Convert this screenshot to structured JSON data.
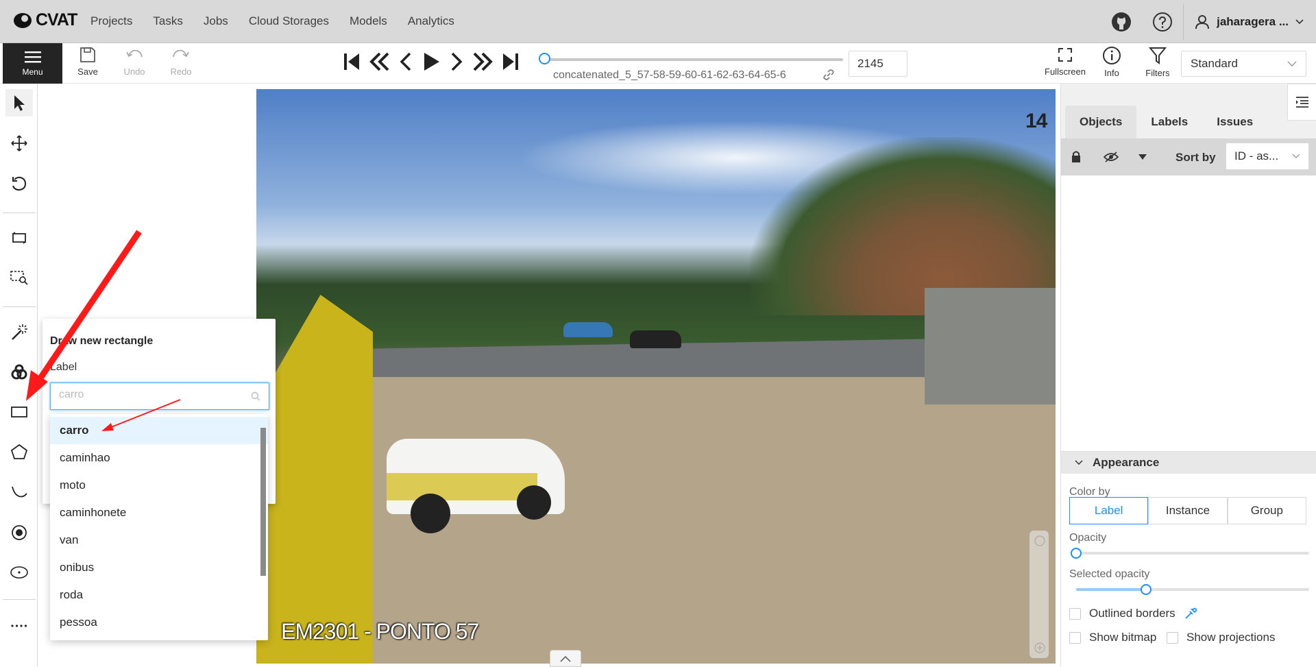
{
  "app": {
    "logo_text": "CVAT"
  },
  "nav": {
    "items": [
      "Projects",
      "Tasks",
      "Jobs",
      "Cloud Storages",
      "Models",
      "Analytics"
    ]
  },
  "user": {
    "name": "jaharagera ..."
  },
  "toolbar": {
    "menu_label": "Menu",
    "save_label": "Save",
    "undo_label": "Undo",
    "redo_label": "Redo",
    "filename": "concatenated_5_57-58-59-60-61-62-63-64-65-6",
    "frame_number": "2145",
    "fullscreen_label": "Fullscreen",
    "info_label": "Info",
    "filters_label": "Filters",
    "workspace": "Standard",
    "frame_progress": 0
  },
  "canvas": {
    "frame_overlay_number": "14",
    "watermark": "EM2301 - PONTO 57"
  },
  "draw_popover": {
    "title": "Draw new rectangle",
    "label_caption": "Label",
    "search_placeholder": "carro"
  },
  "label_dropdown": {
    "options": [
      "carro",
      "caminhao",
      "moto",
      "caminhonete",
      "van",
      "onibus",
      "roda",
      "pessoa"
    ],
    "selected": "carro"
  },
  "right_panel": {
    "tabs": [
      "Objects",
      "Labels",
      "Issues"
    ],
    "active_tab": "Objects",
    "sort_label": "Sort by",
    "sort_value": "ID - as...",
    "appearance": {
      "title": "Appearance",
      "color_by_label": "Color by",
      "color_by_options": [
        "Label",
        "Instance",
        "Group"
      ],
      "color_by_selected": "Label",
      "opacity_label": "Opacity",
      "opacity_value": 0,
      "selected_opacity_label": "Selected opacity",
      "selected_opacity_value": 0.3,
      "outlined_borders_label": "Outlined borders",
      "show_bitmap_label": "Show bitmap",
      "show_projections_label": "Show projections"
    }
  },
  "colors": {
    "accent": "#1890ff",
    "annotation_arrow": "#ff1a1a",
    "menu_bg": "#242424"
  }
}
